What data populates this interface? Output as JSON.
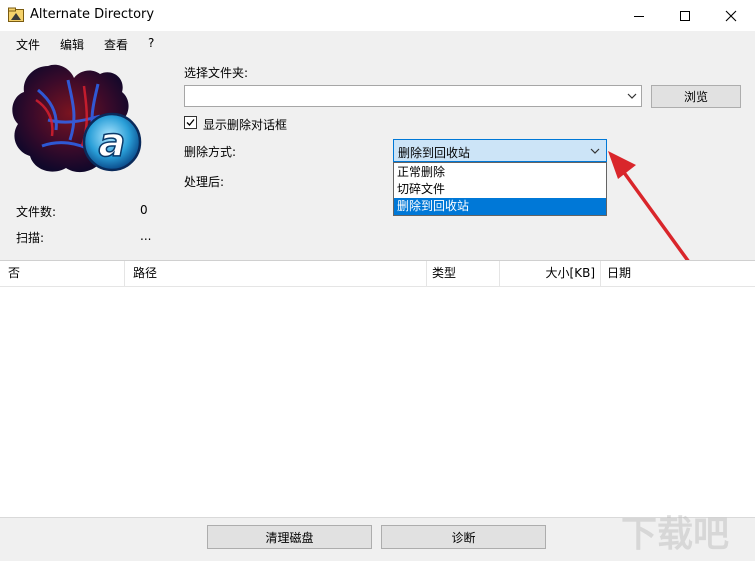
{
  "window": {
    "title": "Alternate Directory",
    "controls": [
      "minimize",
      "maximize",
      "close"
    ]
  },
  "menu": [
    "文件",
    "编辑",
    "查看",
    "?"
  ],
  "form": {
    "select_folder_label": "选择文件夹:",
    "folder_path_value": "",
    "browse_button": "浏览",
    "show_delete_dialog_label": "显示删除对话框",
    "show_delete_dialog_checked": true,
    "delete_mode_label": "删除方式:",
    "delete_mode_value": "删除到回收站",
    "delete_mode_options": [
      "正常删除",
      "切碎文件",
      "删除到回收站"
    ],
    "delete_mode_selected_index": 2,
    "after_process_label": "处理后:"
  },
  "stats": {
    "file_count_label": "文件数:",
    "file_count_value": "0",
    "scan_label": "扫描:",
    "scan_value": "..."
  },
  "table": {
    "columns": [
      "否",
      "路径",
      "类型",
      "大小[KB]",
      "日期"
    ],
    "rows": []
  },
  "bottom": {
    "clean_button": "清理磁盘",
    "diagnose_button": "诊断"
  },
  "watermark": {
    "text": "下载吧"
  },
  "colors": {
    "accent": "#0078d7",
    "arrow": "#d9262b"
  }
}
